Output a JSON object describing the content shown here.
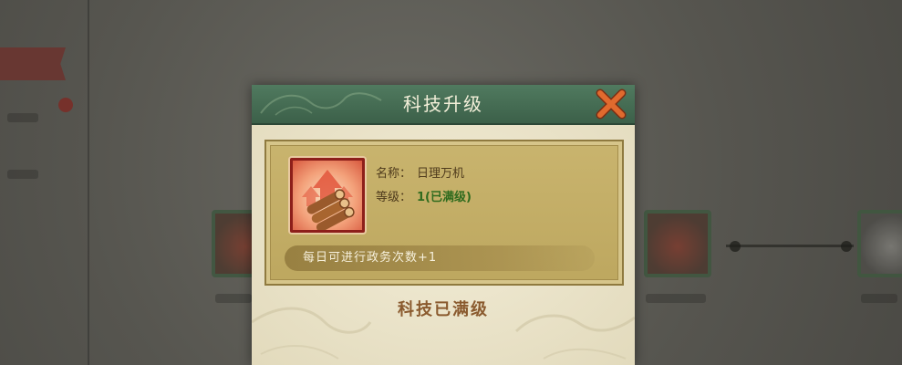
{
  "dialog": {
    "title": "科技升级",
    "close_icon": "close-x-icon",
    "tech": {
      "icon": "wood-logs-upgrade-icon",
      "name_label": "名称：",
      "name_value": "日理万机",
      "level_label": "等级：",
      "level_value": "1(已满级)",
      "effect": "每日可进行政务次数+1"
    },
    "status": "科技已满级"
  },
  "colors": {
    "header_green": "#4a6f55",
    "close_orange": "#d9662f",
    "panel_gold": "#c4ae66",
    "level_green": "#2f6b1e",
    "status_brown": "#8a5a2e"
  }
}
